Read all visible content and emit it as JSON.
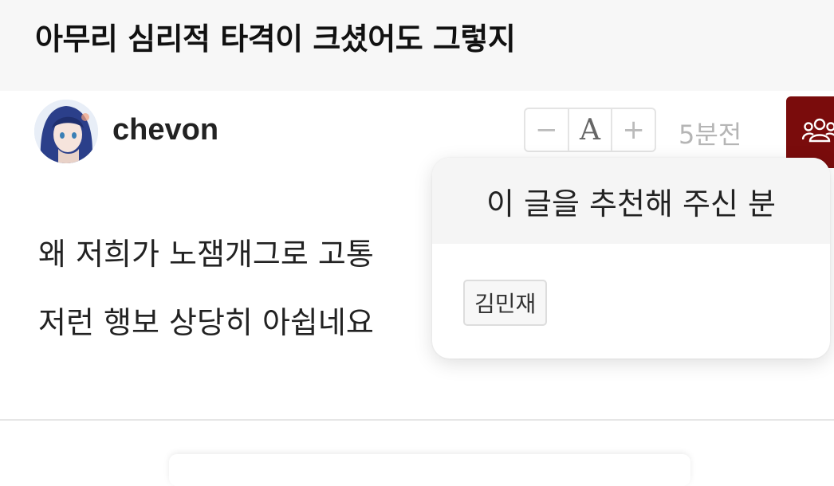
{
  "post": {
    "title": "아무리 심리적 타격이 크셨어도 그렇지",
    "author": "chevon",
    "time_ago": "5분전",
    "body_lines": [
      "왜 저희가 노잼개그로 고통",
      "저런 행보 상당히 아쉽네요"
    ]
  },
  "font_controls": {
    "decrease": "−",
    "label": "A",
    "increase": "+"
  },
  "recommend_button": {
    "icon": "people-icon"
  },
  "recommenders_popup": {
    "title": "이 글을 추천해 주신 분",
    "users": [
      "김민재"
    ]
  },
  "colors": {
    "accent": "#7a0c0c",
    "title_bg": "#f7f7f7",
    "muted": "#b5b5b5"
  }
}
